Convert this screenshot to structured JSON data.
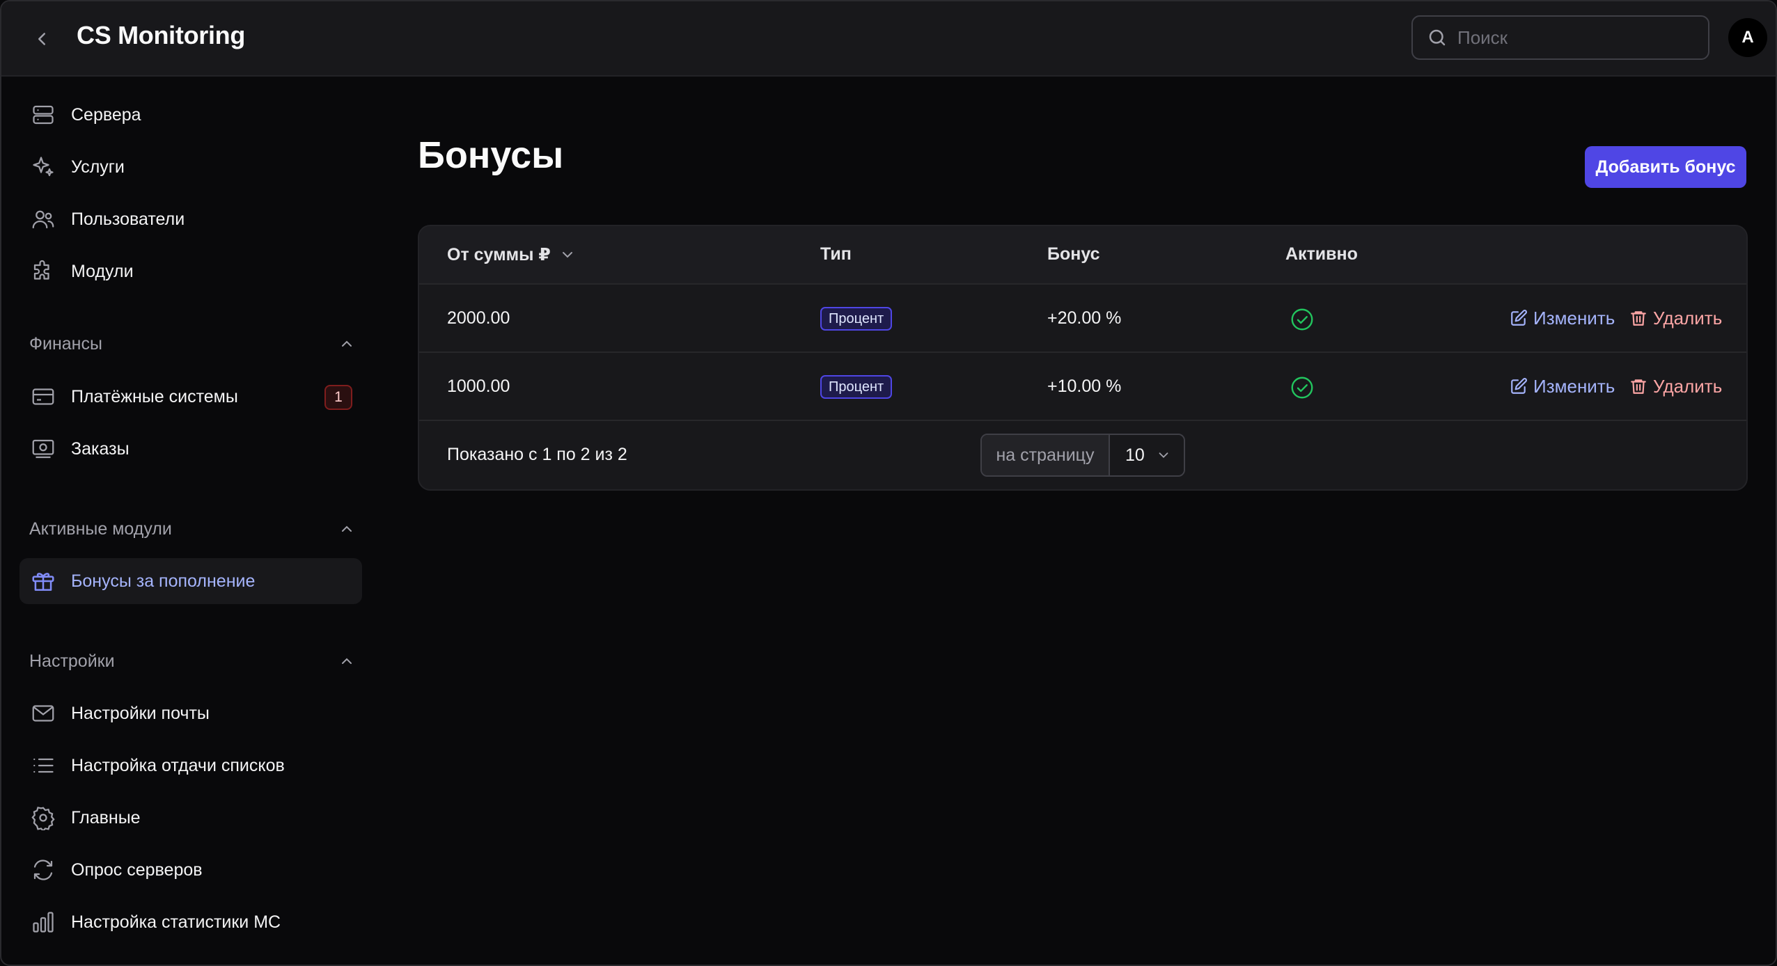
{
  "header": {
    "title": "CS Monitoring",
    "search_placeholder": "Поиск",
    "avatar_initial": "A"
  },
  "sidebar": {
    "main_items": [
      {
        "label": "Сервера",
        "icon": "server-icon"
      },
      {
        "label": "Услуги",
        "icon": "sparkles-icon"
      },
      {
        "label": "Пользователи",
        "icon": "users-icon"
      },
      {
        "label": "Модули",
        "icon": "puzzle-icon"
      }
    ],
    "finance": {
      "title": "Финансы",
      "items": [
        {
          "label": "Платёжные системы",
          "icon": "credit-card-icon",
          "badge": "1"
        },
        {
          "label": "Заказы",
          "icon": "banknote-icon"
        }
      ]
    },
    "modules": {
      "title": "Активные модули",
      "items": [
        {
          "label": "Бонусы за пополнение",
          "icon": "gift-icon",
          "active": true
        }
      ]
    },
    "settings": {
      "title": "Настройки",
      "items": [
        {
          "label": "Настройки почты",
          "icon": "mail-icon"
        },
        {
          "label": "Настройка отдачи списков",
          "icon": "list-icon"
        },
        {
          "label": "Главные",
          "icon": "gear-icon"
        },
        {
          "label": "Опрос серверов",
          "icon": "refresh-icon"
        },
        {
          "label": "Настройка статистики MC",
          "icon": "bar-chart-icon"
        }
      ]
    }
  },
  "main": {
    "title": "Бонусы",
    "add_button": "Добавить бонус",
    "table": {
      "columns": [
        "От суммы ₽",
        "Тип",
        "Бонус",
        "Активно"
      ],
      "rows": [
        {
          "amount": "2000.00",
          "type": "Процент",
          "bonus": "+20.00 %",
          "active": true,
          "edit": "Изменить",
          "delete": "Удалить"
        },
        {
          "amount": "1000.00",
          "type": "Процент",
          "bonus": "+10.00 %",
          "active": true,
          "edit": "Изменить",
          "delete": "Удалить"
        }
      ],
      "footer_text": "Показано с 1 по 2 из 2",
      "per_page_label": "на страницу",
      "per_page_value": "10"
    }
  },
  "colors": {
    "accent": "#4f46e5",
    "active_link": "#a5b4fc",
    "danger": "#fca5a5",
    "success": "#22c55e"
  }
}
